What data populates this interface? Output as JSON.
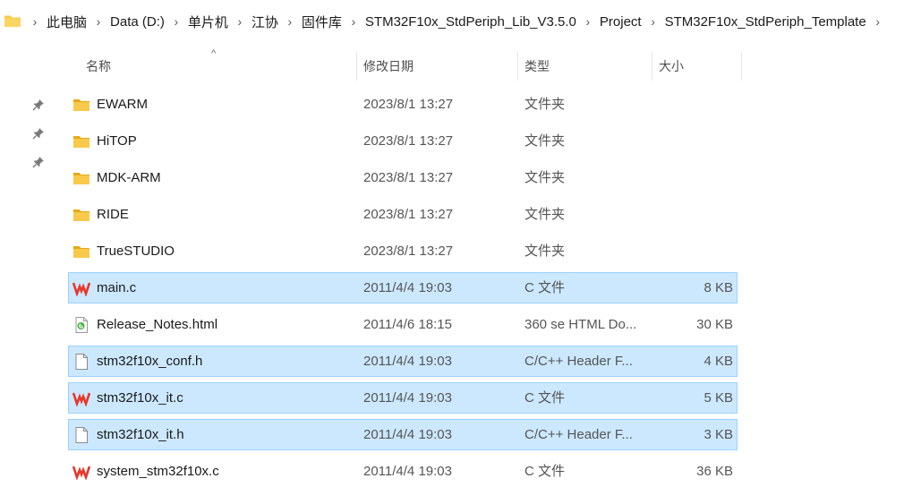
{
  "breadcrumb": {
    "items": [
      "此电脑",
      "Data (D:)",
      "单片机",
      "江协",
      "固件库",
      "STM32F10x_StdPeriph_Lib_V3.5.0",
      "Project",
      "STM32F10x_StdPeriph_Template"
    ],
    "separator": "›"
  },
  "columns": {
    "name": "名称",
    "date": "修改日期",
    "type": "类型",
    "size": "大小",
    "sort_indicator": "^"
  },
  "files": [
    {
      "name": "EWARM",
      "date": "2023/8/1 13:27",
      "type": "文件夹",
      "size": "",
      "icon": "folder-icon",
      "selected": false
    },
    {
      "name": "HiTOP",
      "date": "2023/8/1 13:27",
      "type": "文件夹",
      "size": "",
      "icon": "folder-icon",
      "selected": false
    },
    {
      "name": "MDK-ARM",
      "date": "2023/8/1 13:27",
      "type": "文件夹",
      "size": "",
      "icon": "folder-icon",
      "selected": false
    },
    {
      "name": "RIDE",
      "date": "2023/8/1 13:27",
      "type": "文件夹",
      "size": "",
      "icon": "folder-icon",
      "selected": false
    },
    {
      "name": "TrueSTUDIO",
      "date": "2023/8/1 13:27",
      "type": "文件夹",
      "size": "",
      "icon": "folder-icon",
      "selected": false
    },
    {
      "name": "main.c",
      "date": "2011/4/4 19:03",
      "type": "C 文件",
      "size": "8 KB",
      "icon": "wps-file-icon",
      "selected": true
    },
    {
      "name": "Release_Notes.html",
      "date": "2011/4/6 18:15",
      "type": "360 se HTML Do...",
      "size": "30 KB",
      "icon": "html-file-icon",
      "selected": false
    },
    {
      "name": "stm32f10x_conf.h",
      "date": "2011/4/4 19:03",
      "type": "C/C++ Header F...",
      "size": "4 KB",
      "icon": "blank-file-icon",
      "selected": true
    },
    {
      "name": "stm32f10x_it.c",
      "date": "2011/4/4 19:03",
      "type": "C 文件",
      "size": "5 KB",
      "icon": "wps-file-icon",
      "selected": true
    },
    {
      "name": "stm32f10x_it.h",
      "date": "2011/4/4 19:03",
      "type": "C/C++ Header F...",
      "size": "3 KB",
      "icon": "blank-file-icon",
      "selected": true
    },
    {
      "name": "system_stm32f10x.c",
      "date": "2011/4/4 19:03",
      "type": "C 文件",
      "size": "36 KB",
      "icon": "wps-file-icon",
      "selected": false
    }
  ],
  "quick_access_pins": [
    "pin-icon",
    "pin-icon",
    "pin-icon"
  ],
  "colors": {
    "selection_bg": "#cce8ff",
    "selection_border": "#99d1ff",
    "folder": "#f8c94b",
    "wps_red": "#e8362a"
  }
}
